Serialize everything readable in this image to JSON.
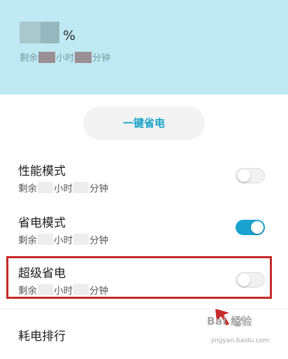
{
  "battery": {
    "percent_sign": "%",
    "remaining_prefix": "剩余",
    "hours_label": "小时",
    "minutes_label": "分钟"
  },
  "one_click_save": {
    "label": "一键省电"
  },
  "modes": [
    {
      "title": "性能模式",
      "prefix": "剩余",
      "hours_label": "小时",
      "minutes_label": "分钟",
      "toggle": "off"
    },
    {
      "title": "省电模式",
      "prefix": "剩余",
      "hours_label": "小时",
      "minutes_label": "分钟",
      "toggle": "on"
    },
    {
      "title": "超级省电",
      "prefix": "剩余",
      "hours_label": "小时",
      "minutes_label": "分钟",
      "toggle": "off"
    }
  ],
  "power_ranking": {
    "label": "耗电排行"
  },
  "watermark": {
    "main": "Bai 经验",
    "sub": "jingyan.baidu.com"
  },
  "colors": {
    "header_bg": "#bfe9f3",
    "accent": "#17a3c8",
    "toggle_on": "#1ba3cf",
    "highlight": "#c62a2a"
  }
}
